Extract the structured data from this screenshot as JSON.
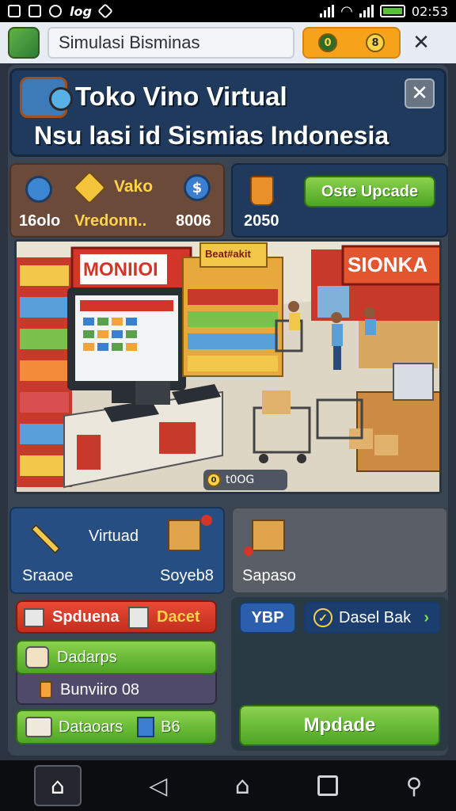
{
  "status_bar": {
    "left_icons": [
      "photo-icon",
      "photo-icon",
      "ghost-icon",
      "chat-icon"
    ],
    "left_text": "log",
    "time": "02:53"
  },
  "app_bar": {
    "title": "Simulasi Bisminas",
    "coin_labels": [
      "0",
      "8"
    ]
  },
  "header": {
    "title": "Toko Vino Virtual",
    "subtitle": "Nsu lasi id Sismias Indonesia"
  },
  "stats": {
    "label_top": "Vako",
    "left_value": "16olo",
    "middle_value": "Vredonn..",
    "right_value": "8006"
  },
  "action": {
    "value": "2050",
    "button_label": "Oste Upcade"
  },
  "scene": {
    "monitor_sign": "MONIIOI",
    "shop_sign": "SIONKA",
    "yellow_sign": "Beat#akit",
    "badge_text": "t0OG",
    "badge_coin": "0"
  },
  "card_left": {
    "title": "Virtuad",
    "left_label": "Sraaoe",
    "right_label": "Soyeb8"
  },
  "card_right": {
    "label": "Sapaso"
  },
  "buttons": {
    "red_left": "Spduena",
    "red_right": "Dacet",
    "chip": "YBP",
    "dasel": "Dasel Bak",
    "green_1": "Dadarps",
    "row_2": "Bunviiro 08",
    "green_3_left": "Dataoars",
    "green_3_right": "B6",
    "update": "Mpdade"
  },
  "colors": {
    "accent_green": "#4ca524",
    "accent_red": "#c42d1d",
    "accent_orange": "#f6a21a",
    "accent_blue": "#274e83"
  }
}
